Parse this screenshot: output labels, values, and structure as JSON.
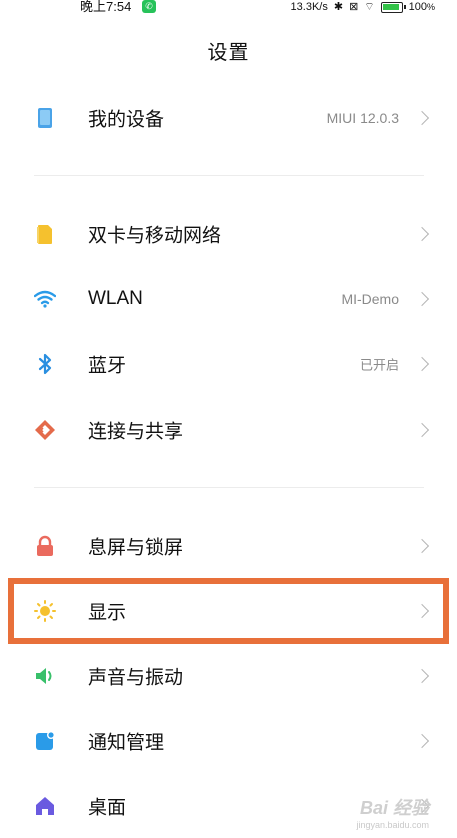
{
  "status_bar": {
    "time": "晚上7:54",
    "network_speed": "13.3K/s",
    "battery": "100",
    "icons": [
      "phone-call-icon",
      "bluetooth-icon",
      "sim-off-icon",
      "wifi-icon",
      "battery-icon"
    ]
  },
  "header": {
    "title": "设置"
  },
  "rows": [
    {
      "label": "我的设备",
      "value": "MIUI 12.0.3",
      "icon": "device-icon",
      "color": "#4aa3e8"
    },
    {
      "label": "双卡与移动网络",
      "value": "",
      "icon": "sim-card-icon",
      "color": "#f5c12e"
    },
    {
      "label": "WLAN",
      "value": "MI-Demo",
      "icon": "wifi-icon",
      "color": "#2a9be8"
    },
    {
      "label": "蓝牙",
      "value": "已开启",
      "icon": "bluetooth-icon",
      "color": "#2a8fe0"
    },
    {
      "label": "连接与共享",
      "value": "",
      "icon": "share-icon",
      "color": "#e46a4a"
    },
    {
      "label": "息屏与锁屏",
      "value": "",
      "icon": "lock-icon",
      "color": "#ea6a5e"
    },
    {
      "label": "显示",
      "value": "",
      "icon": "sun-icon",
      "color": "#f5c12e"
    },
    {
      "label": "声音与振动",
      "value": "",
      "icon": "speaker-icon",
      "color": "#38c06a"
    },
    {
      "label": "通知管理",
      "value": "",
      "icon": "notification-icon",
      "color": "#2a9be8"
    },
    {
      "label": "桌面",
      "value": "",
      "icon": "home-icon",
      "color": "#6a5ae0"
    }
  ],
  "highlight_color": "#e8703a",
  "watermark": {
    "main": "Bai 经验",
    "sub": "jingyan.baidu.com"
  }
}
